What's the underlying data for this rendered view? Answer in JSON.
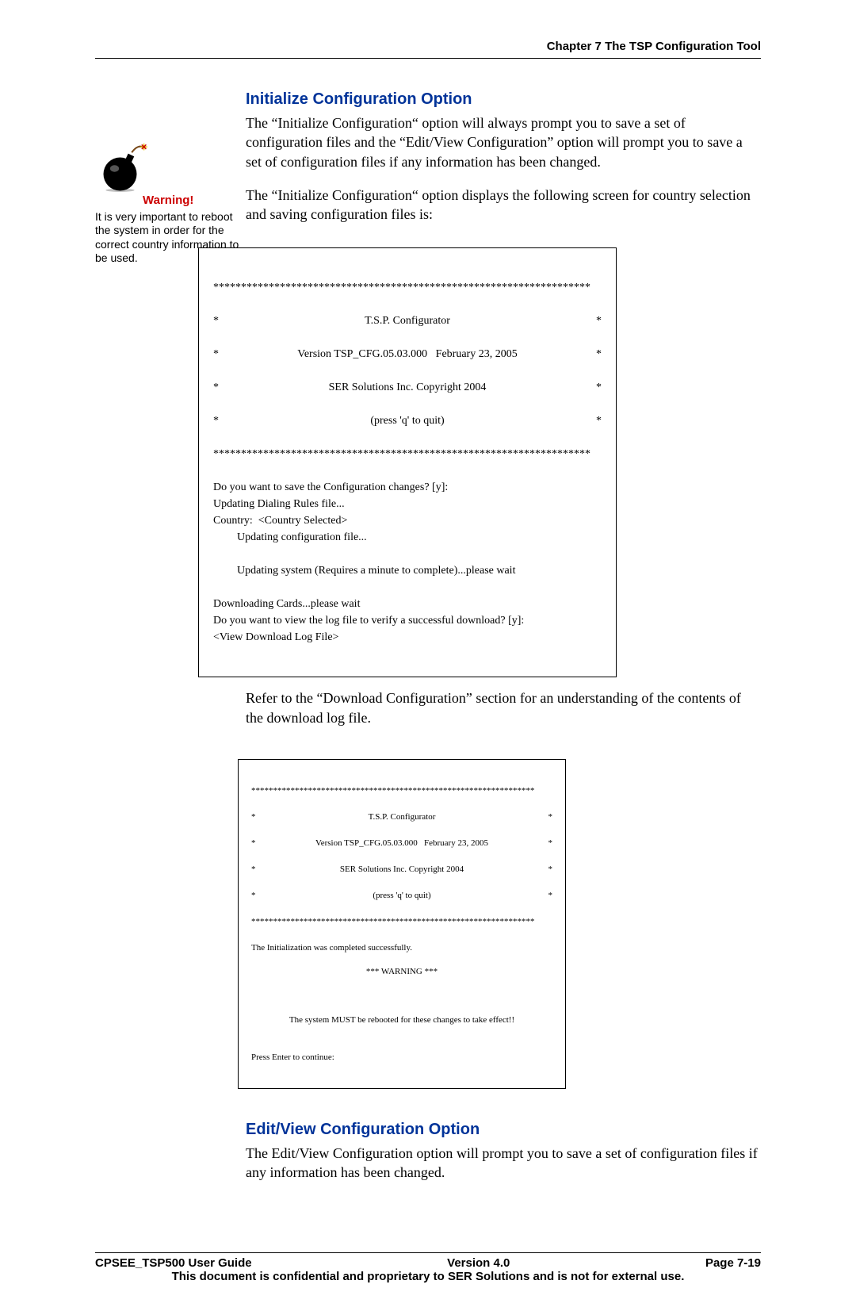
{
  "header": {
    "chapter": "Chapter 7 The TSP Configuration Tool"
  },
  "sidebar": {
    "warning_label": "Warning!",
    "warning_text": "It is very important to reboot the system in order for the correct country information to be used."
  },
  "sections": {
    "init": {
      "title": "Initialize Configuration Option",
      "p1": "The “Initialize Configuration“ option will always prompt you to save a set of configuration files and the “Edit/View Configuration” option will prompt you to save a set of configuration files if any information has been changed.",
      "p2": "The “Initialize Configuration“ option displays the following screen for country selection and saving configuration files is:",
      "p3": "Refer to the “Download Configuration” section for an understanding of the contents of the download log file."
    },
    "editview": {
      "title": "Edit/View Configuration Option",
      "p1": "The Edit/View Configuration option will prompt you to save a set of configuration files if any information has been changed."
    }
  },
  "terminal1": {
    "stars": "********************************************************************",
    "l1": "T.S.P. Configurator",
    "l2": "Version TSP_CFG.05.03.000   February 23, 2005",
    "l3": "SER Solutions Inc. Copyright 2004",
    "l4": "(press 'q' to quit)",
    "q1": "Do you want to save the Configuration changes? [y]:",
    "u1": "Updating Dialing Rules file...",
    "c1": "Country:  <Country Selected>",
    "i1": "Updating configuration file...",
    "i2": "Updating system (Requires a minute to complete)...please wait",
    "d1": "Downloading Cards...please wait",
    "q2": "Do you want to view the log file to verify a successful download? [y]:",
    "v1": "<View Download Log File>"
  },
  "terminal2": {
    "stars": "*****************************************************************",
    "l1": "T.S.P. Configurator",
    "l2": "Version TSP_CFG.05.03.000   February 23, 2005",
    "l3": "SER Solutions Inc. Copyright 2004",
    "l4": "(press 'q' to quit)",
    "m1": "The Initialization was completed successfully.",
    "w1": "*** WARNING ***",
    "m2": "The system MUST be rebooted for these changes to take effect!!",
    "p1": "Press Enter to continue:"
  },
  "footer": {
    "left": "CPSEE_TSP500 User Guide",
    "center": "Version 4.0",
    "right": "Page 7-19",
    "bottom": "This document is confidential and proprietary to SER Solutions and is not for external use."
  }
}
